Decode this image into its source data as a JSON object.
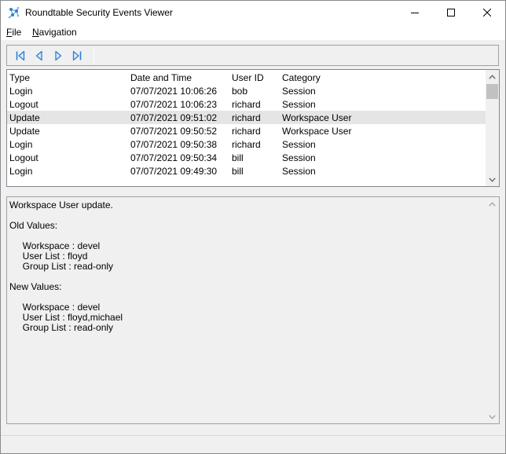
{
  "window": {
    "title": "Roundtable Security Events Viewer"
  },
  "menu": {
    "file": {
      "accel": "F",
      "rest": "ile"
    },
    "navigation": {
      "accel": "N",
      "rest": "avigation"
    }
  },
  "toolbar": {
    "buttons": [
      "first-record-icon",
      "previous-record-icon",
      "next-record-icon",
      "last-record-icon"
    ],
    "icon_color": "#2a7fd4"
  },
  "events": {
    "columns": [
      "Type",
      "Date and Time",
      "User ID",
      "Category"
    ],
    "rows": [
      {
        "type": "Login",
        "datetime": "07/07/2021 10:06:26",
        "user": "bob",
        "category": "Session"
      },
      {
        "type": "Logout",
        "datetime": "07/07/2021 10:06:23",
        "user": "richard",
        "category": "Session"
      },
      {
        "type": "Update",
        "datetime": "07/07/2021 09:51:02",
        "user": "richard",
        "category": "Workspace User"
      },
      {
        "type": "Update",
        "datetime": "07/07/2021 09:50:52",
        "user": "richard",
        "category": "Workspace User"
      },
      {
        "type": "Login",
        "datetime": "07/07/2021 09:50:38",
        "user": "richard",
        "category": "Session"
      },
      {
        "type": "Logout",
        "datetime": "07/07/2021 09:50:34",
        "user": "bill",
        "category": "Session"
      },
      {
        "type": "Login",
        "datetime": "07/07/2021 09:49:30",
        "user": "bill",
        "category": "Session"
      }
    ],
    "selected_index": 2
  },
  "detail": {
    "text": "Workspace User update.\n\nOld Values:\n\n     Workspace : devel\n     User List : floyd\n     Group List : read-only\n\nNew Values:\n\n     Workspace : devel\n     User List : floyd,michael\n     Group List : read-only"
  }
}
